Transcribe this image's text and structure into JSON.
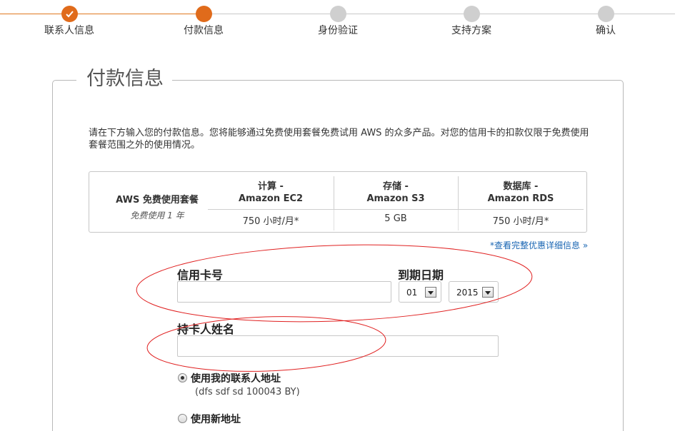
{
  "steps": [
    {
      "label": "联系人信息",
      "state": "done"
    },
    {
      "label": "付款信息",
      "state": "active"
    },
    {
      "label": "身份验证",
      "state": "todo"
    },
    {
      "label": "支持方案",
      "state": "todo"
    },
    {
      "label": "确认",
      "state": "todo"
    }
  ],
  "section_title": "付款信息",
  "intro_text": "请在下方输入您的付款信息。您将能够通过免费使用套餐免费试用 AWS 的众多产品。对您的信用卡的扣款仅限于免费使用套餐范围之外的使用情况。",
  "free_tier": {
    "title": "AWS 免费使用套餐",
    "subtitle": "免费使用 1 年",
    "columns": [
      {
        "name_line1": "计算 -",
        "name_line2": "Amazon EC2",
        "value": "750 小时/月*"
      },
      {
        "name_line1": "存储 -",
        "name_line2": "Amazon S3",
        "value": "5 GB"
      },
      {
        "name_line1": "数据库 -",
        "name_line2": "Amazon RDS",
        "value": "750 小时/月*"
      }
    ]
  },
  "detail_link": "*查看完整优惠详细信息 »",
  "form": {
    "card_number_label": "信用卡号",
    "card_number_value": "",
    "expiry_label": "到期日期",
    "expiry_month": "01",
    "expiry_year": "2015",
    "cardholder_label": "持卡人姓名",
    "cardholder_value": "",
    "address_options": [
      {
        "label": "使用我的联系人地址",
        "detail": "(dfs sdf sd 100043 BY)",
        "selected": true
      },
      {
        "label": "使用新地址",
        "detail": "",
        "selected": false
      }
    ]
  },
  "colors": {
    "accent": "#e06b1b",
    "link": "#1a66b3",
    "annotation": "#e02020"
  }
}
